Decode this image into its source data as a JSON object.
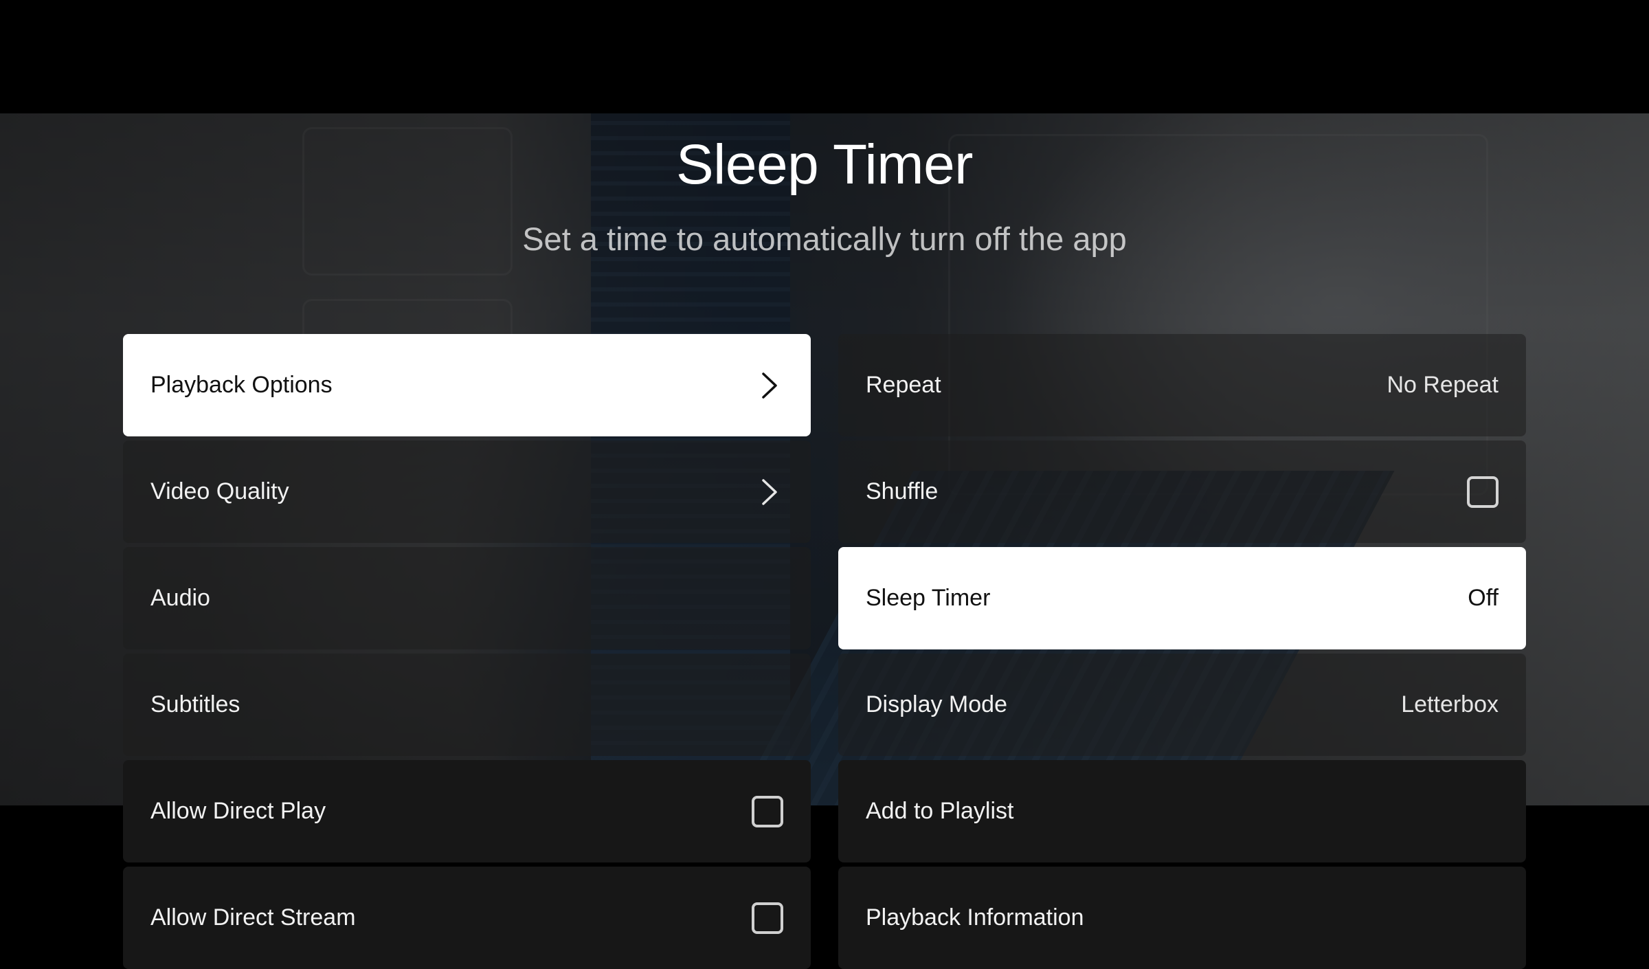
{
  "header": {
    "title": "Sleep Timer",
    "subtitle": "Set a time to automatically turn off the app"
  },
  "left_items": [
    {
      "label": "Playback Options",
      "control": "chevron-right-icon",
      "focused": true
    },
    {
      "label": "Video Quality",
      "control": "chevron-right-icon",
      "focused": false
    },
    {
      "label": "Audio",
      "control": "none",
      "focused": false
    },
    {
      "label": "Subtitles",
      "control": "none",
      "focused": false
    },
    {
      "label": "Allow Direct Play",
      "control": "checkbox",
      "checked": false
    },
    {
      "label": "Allow Direct Stream",
      "control": "checkbox",
      "checked": false
    }
  ],
  "right_items": [
    {
      "label": "Repeat",
      "value": "No Repeat",
      "focused": false
    },
    {
      "label": "Shuffle",
      "control": "checkbox",
      "checked": false
    },
    {
      "label": "Sleep Timer",
      "value": "Off",
      "focused": true
    },
    {
      "label": "Display Mode",
      "value": "Letterbox",
      "focused": false
    },
    {
      "label": "Add to Playlist",
      "value": "",
      "focused": false
    },
    {
      "label": "Playback Information",
      "value": "",
      "focused": false
    }
  ],
  "colors": {
    "focused_bg": "#ffffff",
    "row_bg": "#1e1e1e",
    "text": "#f2f2f2"
  }
}
